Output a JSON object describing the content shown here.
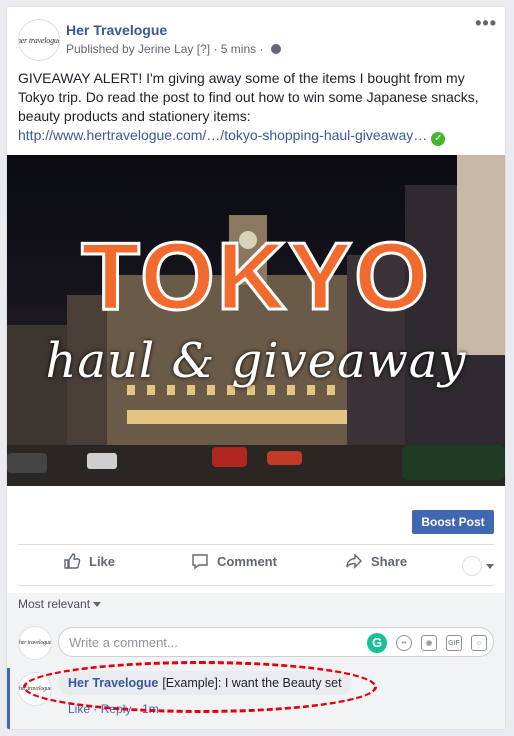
{
  "post": {
    "page_name": "Her Travelogue",
    "avatar_text": "her travelogue",
    "published_by": "Published by Jerine Lay",
    "help_marker": "[?]",
    "time": "· 5 mins ·",
    "more": "•••",
    "body": "GIVEAWAY ALERT! I'm giving away some of the items I bought from my Tokyo trip. Do read the post to find out how to win some Japanese snacks, beauty products and stationery items:",
    "link": "http://www.hertravelogue.com/…/tokyo-shopping-haul-giveaway…",
    "verified_icon": "check-circle-icon"
  },
  "image": {
    "title": "TOKYO",
    "subtitle": "haul & giveaway"
  },
  "boost_label": "Boost Post",
  "actions": {
    "like": "Like",
    "comment": "Comment",
    "share": "Share"
  },
  "comments": {
    "sort_label": "Most relevant",
    "input_placeholder": "Write a comment...",
    "grammarly_label": "G",
    "gif_label": "GIF",
    "items": [
      {
        "author": "Her Travelogue",
        "text": "[Example]: I want the Beauty set",
        "like": "Like",
        "reply": "Reply",
        "time": "1m",
        "sep": "·"
      }
    ]
  },
  "colors": {
    "accent": "#4267b2",
    "link": "#385898",
    "highlight": "#e3000b",
    "tokyo": "#f26a2e"
  }
}
